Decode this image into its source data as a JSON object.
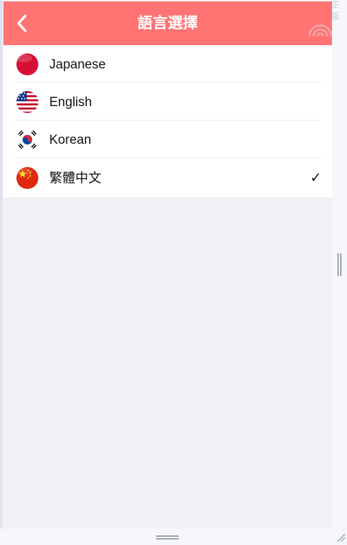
{
  "header": {
    "title": "語言選擇",
    "back_icon": "chevron-left-icon",
    "status_icon": "wifi-icon",
    "background_color": "#ff7373"
  },
  "languages": [
    {
      "label": "Japanese",
      "flag_icon": "japan-flag-icon",
      "selected": false
    },
    {
      "label": "English",
      "flag_icon": "usa-flag-icon",
      "selected": false
    },
    {
      "label": "Korean",
      "flag_icon": "korea-flag-icon",
      "selected": false
    },
    {
      "label": "繁體中文",
      "flag_icon": "china-flag-icon",
      "selected": true
    }
  ],
  "selected_mark": "✓",
  "corner_text": "正版"
}
